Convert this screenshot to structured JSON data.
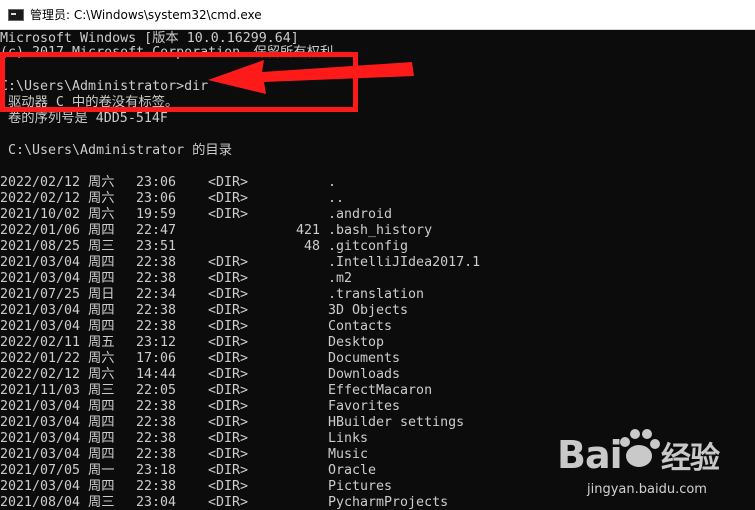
{
  "window": {
    "title": "管理员: C:\\Windows\\system32\\cmd.exe"
  },
  "console": {
    "header_line1": "Microsoft Windows [版本 10.0.16299.64]",
    "header_line2": "(c) 2017 Microsoft Corporation。保留所有权利。",
    "prompt": "C:\\Users\\Administrator>dir",
    "volume_line": " 驱动器 C 中的卷没有标签。",
    "serial_line": " 卷的序列号是 4DD5-514F",
    "dir_of": " C:\\Users\\Administrator 的目录",
    "entries": [
      {
        "date": "2022/02/12",
        "day": "周六",
        "time": "23:06",
        "type": "<DIR>",
        "size": "",
        "name": "."
      },
      {
        "date": "2022/02/12",
        "day": "周六",
        "time": "23:06",
        "type": "<DIR>",
        "size": "",
        "name": ".."
      },
      {
        "date": "2021/10/02",
        "day": "周六",
        "time": "19:59",
        "type": "<DIR>",
        "size": "",
        "name": ".android"
      },
      {
        "date": "2022/01/06",
        "day": "周四",
        "time": "22:47",
        "type": "",
        "size": "421",
        "name": ".bash_history"
      },
      {
        "date": "2021/08/25",
        "day": "周三",
        "time": "23:51",
        "type": "",
        "size": "48",
        "name": ".gitconfig"
      },
      {
        "date": "2021/03/04",
        "day": "周四",
        "time": "22:38",
        "type": "<DIR>",
        "size": "",
        "name": ".IntelliJIdea2017.1"
      },
      {
        "date": "2021/03/04",
        "day": "周四",
        "time": "22:38",
        "type": "<DIR>",
        "size": "",
        "name": ".m2"
      },
      {
        "date": "2021/07/25",
        "day": "周日",
        "time": "22:34",
        "type": "<DIR>",
        "size": "",
        "name": ".translation"
      },
      {
        "date": "2021/03/04",
        "day": "周四",
        "time": "22:38",
        "type": "<DIR>",
        "size": "",
        "name": "3D Objects"
      },
      {
        "date": "2021/03/04",
        "day": "周四",
        "time": "22:38",
        "type": "<DIR>",
        "size": "",
        "name": "Contacts"
      },
      {
        "date": "2022/02/11",
        "day": "周五",
        "time": "23:12",
        "type": "<DIR>",
        "size": "",
        "name": "Desktop"
      },
      {
        "date": "2022/01/22",
        "day": "周六",
        "time": "17:06",
        "type": "<DIR>",
        "size": "",
        "name": "Documents"
      },
      {
        "date": "2022/02/12",
        "day": "周六",
        "time": "14:44",
        "type": "<DIR>",
        "size": "",
        "name": "Downloads"
      },
      {
        "date": "2021/11/03",
        "day": "周三",
        "time": "22:05",
        "type": "<DIR>",
        "size": "",
        "name": "EffectMacaron"
      },
      {
        "date": "2021/03/04",
        "day": "周四",
        "time": "22:38",
        "type": "<DIR>",
        "size": "",
        "name": "Favorites"
      },
      {
        "date": "2021/03/04",
        "day": "周四",
        "time": "22:38",
        "type": "<DIR>",
        "size": "",
        "name": "HBuilder settings"
      },
      {
        "date": "2021/03/04",
        "day": "周四",
        "time": "22:38",
        "type": "<DIR>",
        "size": "",
        "name": "Links"
      },
      {
        "date": "2021/03/04",
        "day": "周四",
        "time": "22:38",
        "type": "<DIR>",
        "size": "",
        "name": "Music"
      },
      {
        "date": "2021/07/05",
        "day": "周一",
        "time": "23:18",
        "type": "<DIR>",
        "size": "",
        "name": "Oracle"
      },
      {
        "date": "2021/03/04",
        "day": "周四",
        "time": "22:38",
        "type": "<DIR>",
        "size": "",
        "name": "Pictures"
      },
      {
        "date": "2021/08/04",
        "day": "周三",
        "time": "23:04",
        "type": "<DIR>",
        "size": "",
        "name": "PycharmProjects"
      }
    ]
  },
  "annotation": {
    "color": "#ff1a1a"
  },
  "watermark": {
    "logo": "Bai du 经验",
    "url": "jingyan.baidu.com"
  }
}
